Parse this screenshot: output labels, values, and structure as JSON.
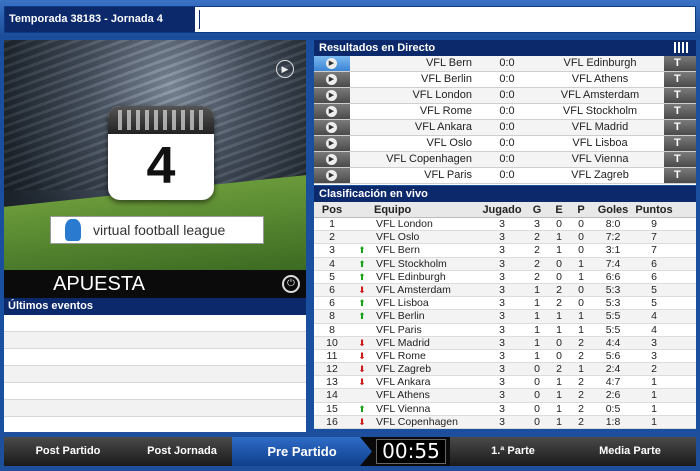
{
  "header": {
    "title": "Temporada 38183 - Jornada 4"
  },
  "video": {
    "jornada_number": "4",
    "logo_text": "virtual football league"
  },
  "bet": {
    "label": "APUESTA"
  },
  "events": {
    "title": "Últimos eventos",
    "rows": 7
  },
  "results": {
    "title": "Resultados en Directo",
    "matches": [
      {
        "home": "VFL Bern",
        "score": "0:0",
        "away": "VFL Edinburgh",
        "active": true
      },
      {
        "home": "VFL Berlin",
        "score": "0:0",
        "away": "VFL Athens",
        "active": false
      },
      {
        "home": "VFL London",
        "score": "0:0",
        "away": "VFL Amsterdam",
        "active": false
      },
      {
        "home": "VFL Rome",
        "score": "0:0",
        "away": "VFL Stockholm",
        "active": false
      },
      {
        "home": "VFL Ankara",
        "score": "0:0",
        "away": "VFL Madrid",
        "active": false
      },
      {
        "home": "VFL Oslo",
        "score": "0:0",
        "away": "VFL Lisboa",
        "active": false
      },
      {
        "home": "VFL Copenhagen",
        "score": "0:0",
        "away": "VFL Vienna",
        "active": false
      },
      {
        "home": "VFL Paris",
        "score": "0:0",
        "away": "VFL Zagreb",
        "active": false
      }
    ]
  },
  "standings": {
    "title": "Clasificación en vivo",
    "columns": {
      "pos": "Pos",
      "team": "Equipo",
      "played": "Jugado",
      "won": "G",
      "drawn": "E",
      "lost": "P",
      "goals": "Goles",
      "points": "Puntos"
    },
    "rows": [
      {
        "pos": "1",
        "trend": "",
        "team": "VFL London",
        "played": "3",
        "won": "3",
        "drawn": "0",
        "lost": "0",
        "goals": "8:0",
        "points": "9"
      },
      {
        "pos": "2",
        "trend": "",
        "team": "VFL Oslo",
        "played": "3",
        "won": "2",
        "drawn": "1",
        "lost": "0",
        "goals": "7:2",
        "points": "7"
      },
      {
        "pos": "3",
        "trend": "up",
        "team": "VFL Bern",
        "played": "3",
        "won": "2",
        "drawn": "1",
        "lost": "0",
        "goals": "3:1",
        "points": "7"
      },
      {
        "pos": "4",
        "trend": "up",
        "team": "VFL Stockholm",
        "played": "3",
        "won": "2",
        "drawn": "0",
        "lost": "1",
        "goals": "7:4",
        "points": "6"
      },
      {
        "pos": "5",
        "trend": "up",
        "team": "VFL Edinburgh",
        "played": "3",
        "won": "2",
        "drawn": "0",
        "lost": "1",
        "goals": "6:6",
        "points": "6"
      },
      {
        "pos": "6",
        "trend": "down",
        "team": "VFL Amsterdam",
        "played": "3",
        "won": "1",
        "drawn": "2",
        "lost": "0",
        "goals": "5:3",
        "points": "5"
      },
      {
        "pos": "6",
        "trend": "up",
        "team": "VFL Lisboa",
        "played": "3",
        "won": "1",
        "drawn": "2",
        "lost": "0",
        "goals": "5:3",
        "points": "5"
      },
      {
        "pos": "8",
        "trend": "up",
        "team": "VFL Berlin",
        "played": "3",
        "won": "1",
        "drawn": "1",
        "lost": "1",
        "goals": "5:5",
        "points": "4"
      },
      {
        "pos": "8",
        "trend": "",
        "team": "VFL Paris",
        "played": "3",
        "won": "1",
        "drawn": "1",
        "lost": "1",
        "goals": "5:5",
        "points": "4"
      },
      {
        "pos": "10",
        "trend": "down",
        "team": "VFL Madrid",
        "played": "3",
        "won": "1",
        "drawn": "0",
        "lost": "2",
        "goals": "4:4",
        "points": "3"
      },
      {
        "pos": "11",
        "trend": "down",
        "team": "VFL Rome",
        "played": "3",
        "won": "1",
        "drawn": "0",
        "lost": "2",
        "goals": "5:6",
        "points": "3"
      },
      {
        "pos": "12",
        "trend": "down",
        "team": "VFL Zagreb",
        "played": "3",
        "won": "0",
        "drawn": "2",
        "lost": "1",
        "goals": "2:4",
        "points": "2"
      },
      {
        "pos": "13",
        "trend": "down",
        "team": "VFL Ankara",
        "played": "3",
        "won": "0",
        "drawn": "1",
        "lost": "2",
        "goals": "4:7",
        "points": "1"
      },
      {
        "pos": "14",
        "trend": "",
        "team": "VFL Athens",
        "played": "3",
        "won": "0",
        "drawn": "1",
        "lost": "2",
        "goals": "2:6",
        "points": "1"
      },
      {
        "pos": "15",
        "trend": "up",
        "team": "VFL Vienna",
        "played": "3",
        "won": "0",
        "drawn": "1",
        "lost": "2",
        "goals": "0:5",
        "points": "1"
      },
      {
        "pos": "16",
        "trend": "down",
        "team": "VFL Copenhagen",
        "played": "3",
        "won": "0",
        "drawn": "1",
        "lost": "2",
        "goals": "1:8",
        "points": "1"
      }
    ]
  },
  "phases": {
    "post_partido": "Post Partido",
    "post_jornada": "Post Jornada",
    "pre_partido": "Pre Partido",
    "timer": "00:55",
    "primera_parte": "1.ª Parte",
    "media_parte": "Media Parte"
  }
}
